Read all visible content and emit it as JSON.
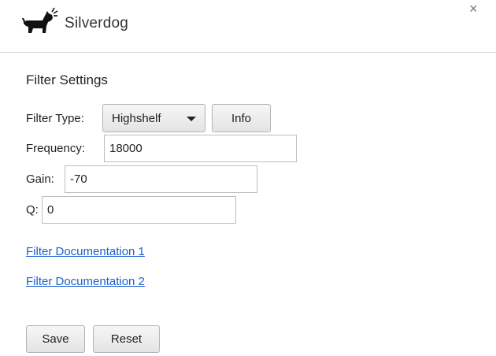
{
  "app": {
    "name": "Silverdog",
    "close_symbol": "×"
  },
  "section": {
    "title": "Filter Settings"
  },
  "filter_type": {
    "label": "Filter Type:",
    "selected": "Highshelf",
    "info_label": "Info"
  },
  "frequency": {
    "label": "Frequency:",
    "value": "18000"
  },
  "gain": {
    "label": "Gain:",
    "value": "-70"
  },
  "q": {
    "label": "Q:",
    "value": "0"
  },
  "links": {
    "doc1": "Filter Documentation 1",
    "doc2": "Filter Documentation 2"
  },
  "actions": {
    "save": "Save",
    "reset": "Reset"
  },
  "icons": {
    "logo": "dog-barking-icon",
    "close": "close-icon",
    "dropdown": "caret-down-icon"
  },
  "colors": {
    "link": "#1a5fd0",
    "divider": "#d8d8d8",
    "button_border": "#b3b3b3"
  }
}
